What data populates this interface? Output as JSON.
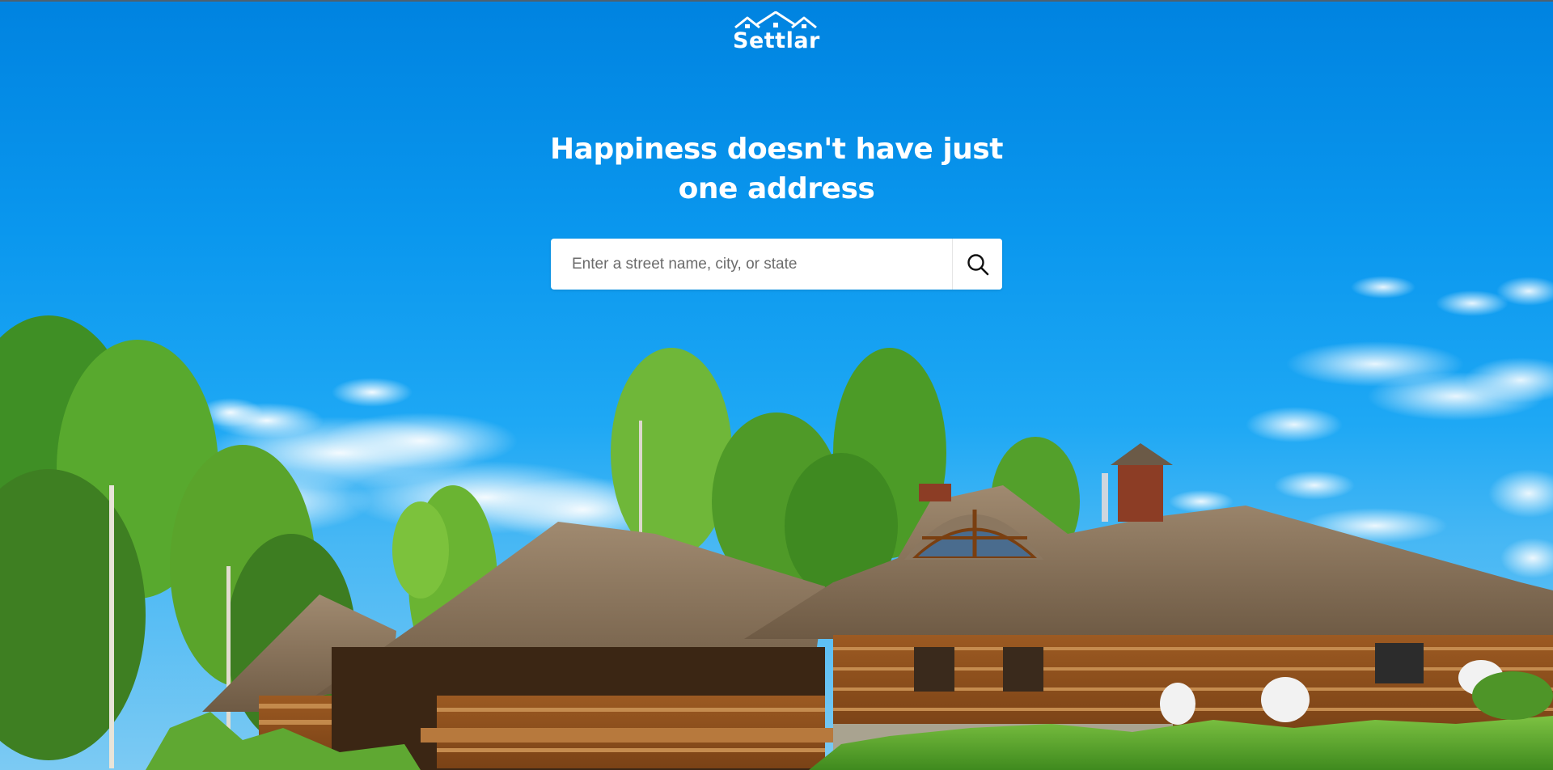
{
  "brand": {
    "name": "Settlar",
    "logo_icon": "house-roofs-icon"
  },
  "hero": {
    "headline_line1": "Happiness doesn't have just",
    "headline_line2": "one address",
    "background": "log-house-with-thatched-roof-photo"
  },
  "search": {
    "placeholder": "Enter a street name, city, or state",
    "value": "",
    "button_icon": "search-icon"
  },
  "colors": {
    "sky": "#0a97ee",
    "headline": "#ffffff",
    "search_bg": "#ffffff",
    "icon": "#111111"
  }
}
